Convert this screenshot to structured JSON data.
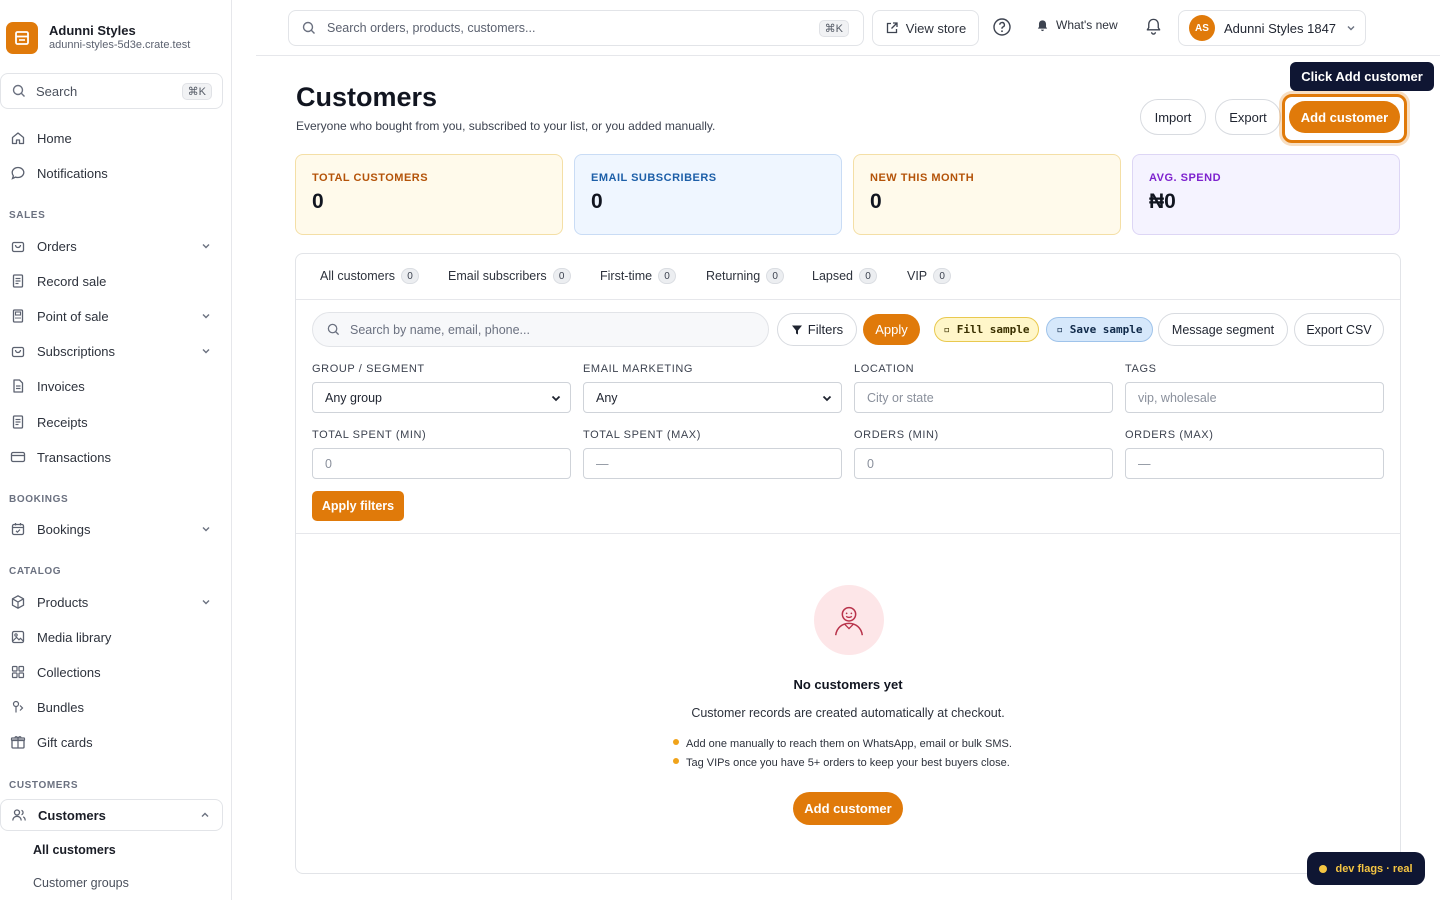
{
  "brand": {
    "name": "Adunni Styles",
    "domain": "adunni-styles-5d3e.crate.test"
  },
  "sidebar": {
    "search_label": "Search",
    "search_shortcut": "⌘K",
    "top_items": [
      {
        "label": "Home",
        "icon": "home-icon"
      },
      {
        "label": "Notifications",
        "icon": "chat-bubble-icon"
      }
    ],
    "sections": {
      "sales": "SALES",
      "bookings": "BOOKINGS",
      "catalog": "CATALOG",
      "customers": "CUSTOMERS"
    },
    "sales_items": [
      {
        "label": "Orders",
        "icon": "bag-icon",
        "expandable": true
      },
      {
        "label": "Record sale",
        "icon": "receipt-icon",
        "expandable": false
      },
      {
        "label": "Point of sale",
        "icon": "pos-icon",
        "expandable": true
      },
      {
        "label": "Subscriptions",
        "icon": "bag-icon",
        "expandable": true
      },
      {
        "label": "Invoices",
        "icon": "document-icon",
        "expandable": false
      },
      {
        "label": "Receipts",
        "icon": "receipt-icon",
        "expandable": false
      },
      {
        "label": "Transactions",
        "icon": "card-icon",
        "expandable": false
      }
    ],
    "booking_items": [
      {
        "label": "Bookings",
        "icon": "calendar-icon",
        "expandable": true
      }
    ],
    "catalog_items": [
      {
        "label": "Products",
        "icon": "box-icon",
        "expandable": true
      },
      {
        "label": "Media library",
        "icon": "image-icon",
        "expandable": false
      },
      {
        "label": "Collections",
        "icon": "grid-icon",
        "expandable": false
      },
      {
        "label": "Bundles",
        "icon": "bundle-icon",
        "expandable": false
      },
      {
        "label": "Gift cards",
        "icon": "gift-icon",
        "expandable": false
      }
    ],
    "customers_item": {
      "label": "Customers",
      "icon": "users-icon"
    },
    "customers_sub": [
      "All customers",
      "Customer groups"
    ]
  },
  "topbar": {
    "search_placeholder": "Search orders, products, customers...",
    "search_shortcut": "⌘K",
    "view_store": "View store",
    "whats_new": "What's new",
    "account_initials": "AS",
    "account_name": "Adunni Styles 1847"
  },
  "page": {
    "title": "Customers",
    "subtitle": "Everyone who bought from you, subscribed to your list, or you added manually.",
    "import": "Import",
    "export": "Export",
    "add_customer": "Add customer",
    "tooltip": "Click Add customer"
  },
  "stats": [
    {
      "label": "TOTAL CUSTOMERS",
      "value": "0",
      "bg": "#fffaeb",
      "border": "#f4dfa6",
      "color": "#b45309"
    },
    {
      "label": "EMAIL SUBSCRIBERS",
      "value": "0",
      "bg": "#eff6ff",
      "border": "#c9dcf5",
      "color": "#1d5fa8"
    },
    {
      "label": "NEW THIS MONTH",
      "value": "0",
      "bg": "#fffaeb",
      "border": "#f4dfa6",
      "color": "#b45309"
    },
    {
      "label": "AVG. SPEND",
      "value": "₦0",
      "bg": "#f5f3ff",
      "border": "#ddd6f5",
      "color": "#7e22ce"
    }
  ],
  "tabs": [
    {
      "label": "All customers",
      "count": "0"
    },
    {
      "label": "Email subscribers",
      "count": "0"
    },
    {
      "label": "First-time",
      "count": "0"
    },
    {
      "label": "Returning",
      "count": "0"
    },
    {
      "label": "Lapsed",
      "count": "0"
    },
    {
      "label": "VIP",
      "count": "0"
    }
  ],
  "toolbar": {
    "search_placeholder": "Search by name, email, phone...",
    "filters": "Filters",
    "apply": "Apply",
    "fill_sample": "▫ Fill sample",
    "save_sample": "▫ Save sample",
    "message_segment": "Message segment",
    "export_csv": "Export CSV"
  },
  "filters": {
    "group_label": "GROUP / SEGMENT",
    "group_value": "Any group",
    "email_label": "EMAIL MARKETING",
    "email_value": "Any",
    "location_label": "LOCATION",
    "location_placeholder": "City or state",
    "tags_label": "TAGS",
    "tags_placeholder": "vip, wholesale",
    "spent_min_label": "TOTAL SPENT (MIN)",
    "spent_min_placeholder": "0",
    "spent_max_label": "TOTAL SPENT (MAX)",
    "spent_max_placeholder": "—",
    "orders_min_label": "ORDERS (MIN)",
    "orders_min_placeholder": "0",
    "orders_max_label": "ORDERS (MAX)",
    "orders_max_placeholder": "—",
    "apply_filters": "Apply filters"
  },
  "empty_state": {
    "title": "No customers yet",
    "description": "Customer records are created automatically at checkout.",
    "tips": [
      "Add one manually to reach them on WhatsApp, email or bulk SMS.",
      "Tag VIPs once you have 5+ orders to keep your best buyers close."
    ],
    "cta": "Add customer"
  },
  "dev_flags": "dev flags · real",
  "colors": {
    "accent": "#e07a0a",
    "dark": "#0f1633"
  }
}
